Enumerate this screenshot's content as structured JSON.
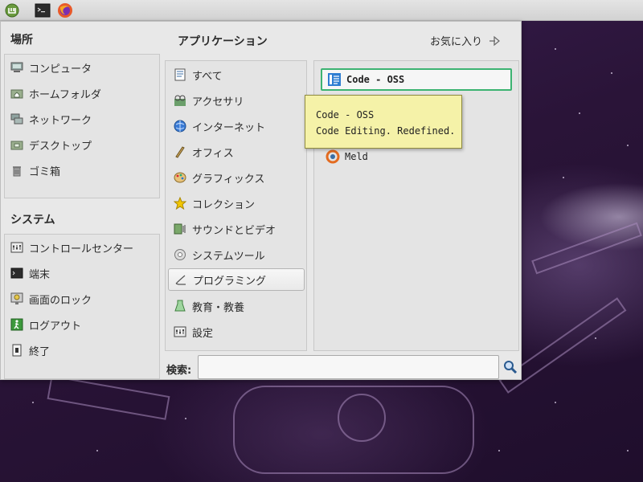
{
  "panel": {
    "launchers": [
      {
        "icon": "mint-menu-icon"
      },
      {
        "icon": "terminal-icon"
      },
      {
        "icon": "firefox-icon"
      }
    ]
  },
  "places": {
    "title": "場所",
    "items": [
      {
        "label": "コンピュータ",
        "icon": "computer-icon"
      },
      {
        "label": "ホームフォルダ",
        "icon": "home-folder-icon"
      },
      {
        "label": "ネットワーク",
        "icon": "network-icon"
      },
      {
        "label": "デスクトップ",
        "icon": "desktop-folder-icon"
      },
      {
        "label": "ゴミ箱",
        "icon": "trash-icon"
      }
    ]
  },
  "system": {
    "title": "システム",
    "items": [
      {
        "label": "コントロールセンター",
        "icon": "control-center-icon"
      },
      {
        "label": "端末",
        "icon": "terminal-icon"
      },
      {
        "label": "画面のロック",
        "icon": "lock-screen-icon"
      },
      {
        "label": "ログアウト",
        "icon": "logout-icon"
      },
      {
        "label": "終了",
        "icon": "shutdown-icon"
      }
    ]
  },
  "applications": {
    "title": "アプリケーション",
    "favorites_label": "お気に入り",
    "categories": [
      {
        "label": "すべて",
        "icon": "all-apps-icon"
      },
      {
        "label": "アクセサリ",
        "icon": "accessories-icon"
      },
      {
        "label": "インターネット",
        "icon": "internet-globe-icon"
      },
      {
        "label": "オフィス",
        "icon": "office-icon"
      },
      {
        "label": "グラフィックス",
        "icon": "graphics-icon"
      },
      {
        "label": "コレクション",
        "icon": "star-icon"
      },
      {
        "label": "サウンドとビデオ",
        "icon": "sound-video-icon"
      },
      {
        "label": "システムツール",
        "icon": "system-tools-icon"
      },
      {
        "label": "プログラミング",
        "icon": "programming-icon",
        "selected": true
      },
      {
        "label": "教育・教養",
        "icon": "education-icon"
      },
      {
        "label": "設定",
        "icon": "settings-icon"
      }
    ],
    "apps": [
      {
        "label": "Code - OSS",
        "icon": "vscode-icon",
        "focused": true
      },
      {
        "label": "Meld",
        "icon": "meld-icon"
      }
    ]
  },
  "tooltip": {
    "line1": "Code - OSS",
    "line2": "Code Editing. Redefined."
  },
  "search": {
    "label": "検索:",
    "value": "",
    "placeholder": ""
  },
  "colors": {
    "focus_border": "#3cb371",
    "tooltip_bg": "#f5f2a8",
    "menu_bg": "#e8e8e8"
  }
}
